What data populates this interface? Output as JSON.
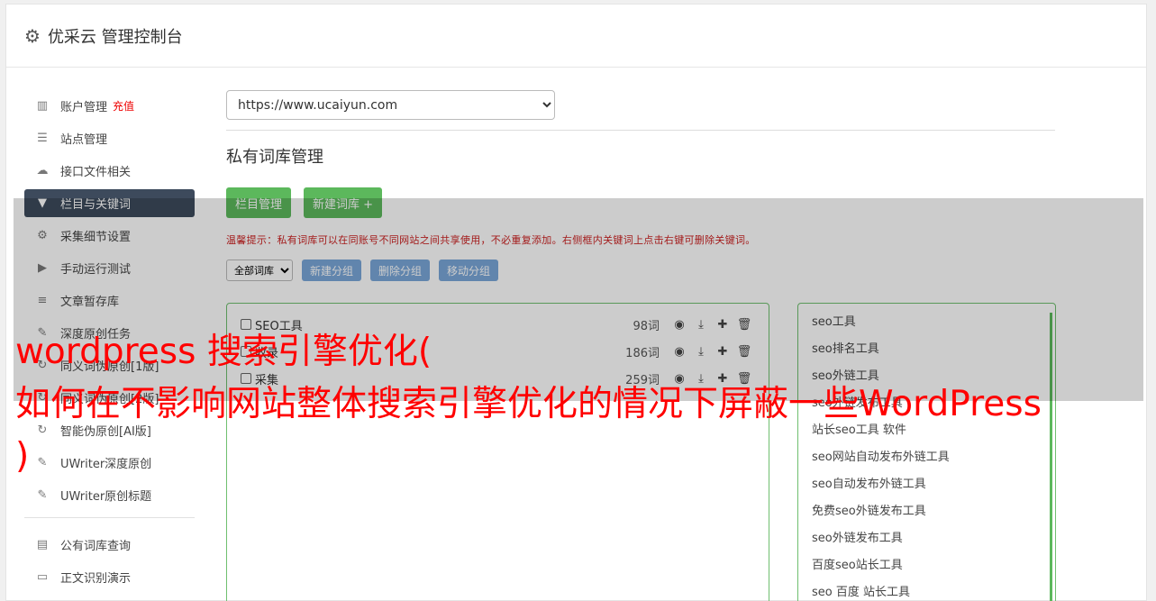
{
  "header": {
    "title": "优采云 管理控制台",
    "icon": "gear-icon"
  },
  "sidebar": {
    "items": [
      {
        "label": "账户管理",
        "icon": "bar-chart-icon",
        "badge": "充值"
      },
      {
        "label": "站点管理",
        "icon": "server-icon"
      },
      {
        "label": "接口文件相关",
        "icon": "cloud-upload-icon"
      },
      {
        "label": "栏目与关键词",
        "icon": "filter-icon",
        "active": true
      },
      {
        "label": "采集细节设置",
        "icon": "cogs-icon"
      },
      {
        "label": "手动运行测试",
        "icon": "play-circle-icon"
      },
      {
        "label": "文章暂存库",
        "icon": "database-icon"
      },
      {
        "label": "深度原创任务",
        "icon": "edit-icon"
      },
      {
        "label": "同义词伪原创[1版]",
        "icon": "refresh-icon"
      },
      {
        "label": "同义词伪原创[2版]",
        "icon": "refresh-icon"
      },
      {
        "label": "智能伪原创[AI版]",
        "icon": "refresh-icon"
      },
      {
        "label": "UWriter深度原创",
        "icon": "edit-icon"
      },
      {
        "label": "UWriter原创标题",
        "icon": "edit-icon"
      }
    ],
    "items2": [
      {
        "label": "公有词库查询",
        "icon": "book-icon"
      },
      {
        "label": "正文识别演示",
        "icon": "monitor-icon"
      }
    ]
  },
  "main": {
    "site_select": "https://www.ucaiyun.com",
    "page_title": "私有词库管理",
    "buttons": {
      "column_manage": "栏目管理",
      "new_library": "新建词库 +"
    },
    "tip": "温馨提示：私有词库可以在同账号不同网站之间共享使用，不必重复添加。右侧框内关键词上点击右键可删除关键词。",
    "toolbar": {
      "filter_select": "全部词库",
      "new_group": "新建分组",
      "delete_group": "删除分组",
      "move_group": "移动分组"
    },
    "libraries": [
      {
        "name": "SEO工具",
        "count": "98词"
      },
      {
        "name": "收录",
        "count": "186词"
      },
      {
        "name": "采集",
        "count": "259词"
      }
    ],
    "keywords": [
      "seo工具",
      "seo排名工具",
      "seo外链工具",
      "seo外链发布工具",
      "站长seo工具 软件",
      "seo网站自动发布外链工具",
      "seo自动发布外链工具",
      "免费seo外链发布工具",
      "seo外链发布工具",
      "百度seo站长工具",
      "seo 百度 站长工具"
    ]
  },
  "overlay_headline": "wordpress 搜索引擎优化(\n如何在不影响网站整体搜索引擎优化的情况下屏蔽一些WordPress\n)",
  "colors": {
    "accent_green": "#5cb85c",
    "active_nav": "#3d4a5c",
    "headline_red": "#ff0000"
  }
}
